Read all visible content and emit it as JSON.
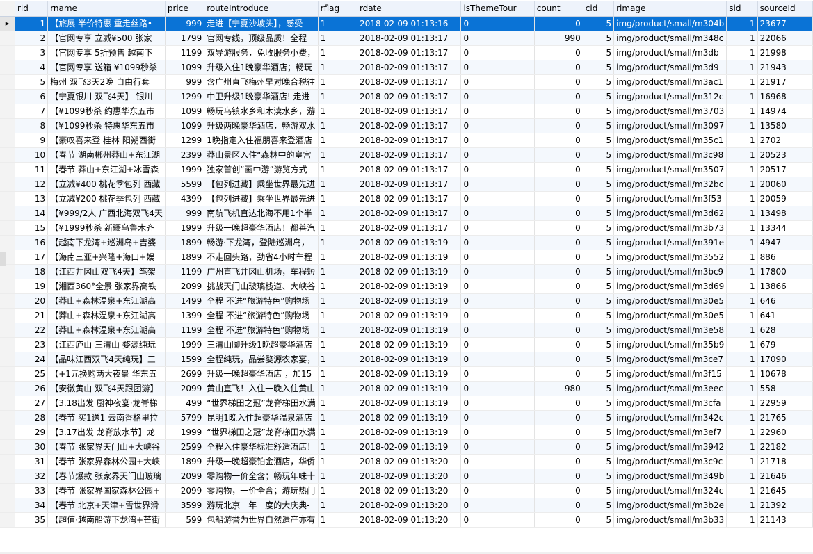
{
  "columns": [
    "rid",
    "rname",
    "price",
    "routeIntroduce",
    "rflag",
    "rdate",
    "isThemeTour",
    "count",
    "cid",
    "rimage",
    "sid",
    "sourceId"
  ],
  "current_row_marker": "▸",
  "selected_row_index": 0,
  "rows": [
    [
      "1",
      "【旅展 半价特惠 重走丝路•",
      "999",
      "走进【宁夏沙坡头】，感受",
      "1",
      "2018-02-09 01:13:16",
      "0",
      "0",
      "5",
      "img/product/small/m304b",
      "1",
      "23677"
    ],
    [
      "2",
      "【官网专享 立减¥500 张家",
      "1799",
      "官网专线，顶级品质！全程",
      "1",
      "2018-02-09 01:13:17",
      "0",
      "990",
      "5",
      "img/product/small/m348c",
      "1",
      "22066"
    ],
    [
      "3",
      "【官网专享 5折预售 越南下",
      "1199",
      "双导游服务，免收服务小费，",
      "1",
      "2018-02-09 01:13:17",
      "0",
      "0",
      "5",
      "img/product/small/m3db",
      "1",
      "21998"
    ],
    [
      "4",
      "【官网专享 送箱 ¥1099秒杀",
      "1099",
      "升级入住1晚豪华酒店；畅玩",
      "1",
      "2018-02-09 01:13:17",
      "0",
      "0",
      "5",
      "img/product/small/m3d9",
      "1",
      "21943"
    ],
    [
      "5",
      "梅州 双飞3天2晚 自由行套",
      "999",
      "含广州直飞梅州早对晚合税往",
      "1",
      "2018-02-09 01:13:17",
      "0",
      "0",
      "5",
      "img/product/small/m3ac1",
      "1",
      "21917"
    ],
    [
      "6",
      "【宁夏银川 双飞4天】 银川",
      "1299",
      "中卫升级1晚豪华酒店! 走进",
      "1",
      "2018-02-09 01:13:17",
      "0",
      "0",
      "5",
      "img/product/small/m312c",
      "1",
      "16968"
    ],
    [
      "7",
      "【¥1099秒杀 约惠华东五市",
      "1099",
      "畅玩乌镇水乡和木渎水乡，游",
      "1",
      "2018-02-09 01:13:17",
      "0",
      "0",
      "5",
      "img/product/small/m3703",
      "1",
      "14974"
    ],
    [
      "8",
      "【¥1099秒杀 特惠华东五市",
      "1099",
      "升级两晚豪华酒店，畅游双水",
      "1",
      "2018-02-09 01:13:17",
      "0",
      "0",
      "5",
      "img/product/small/m3097",
      "1",
      "13580"
    ],
    [
      "9",
      "【豪叹喜来登 桂林 阳朔西街",
      "1299",
      "1晚指定入住福朋喜来登酒店",
      "1",
      "2018-02-09 01:13:17",
      "0",
      "0",
      "5",
      "img/product/small/m35c1",
      "1",
      "2702"
    ],
    [
      "10",
      "【春节 湖南郴州莽山+东江湖",
      "2399",
      "莽山景区入住“森林中的皇宫",
      "1",
      "2018-02-09 01:13:17",
      "0",
      "0",
      "5",
      "img/product/small/m3c98",
      "1",
      "20523"
    ],
    [
      "11",
      "【春节 莽山+东江湖+冰雪森",
      "1999",
      "独家首创“画中游”游览方式-",
      "1",
      "2018-02-09 01:13:17",
      "0",
      "0",
      "5",
      "img/product/small/m3507",
      "1",
      "20517"
    ],
    [
      "12",
      "【立减¥400 桃花季包列 西藏",
      "5599",
      "【包列进藏】乘坐世界最先进",
      "1",
      "2018-02-09 01:13:17",
      "0",
      "0",
      "5",
      "img/product/small/m32bc",
      "1",
      "20060"
    ],
    [
      "13",
      "【立减¥200 桃花季包列 西藏",
      "4399",
      "【包列进藏】乘坐世界最先进",
      "1",
      "2018-02-09 01:13:17",
      "0",
      "0",
      "5",
      "img/product/small/m3f53",
      "1",
      "20059"
    ],
    [
      "14",
      "【¥999/2人 广西北海双飞4天",
      "999",
      "南航飞机直达北海不用1个半",
      "1",
      "2018-02-09 01:13:17",
      "0",
      "0",
      "5",
      "img/product/small/m3d62",
      "1",
      "13498"
    ],
    [
      "15",
      "【¥1999秒杀 新疆乌鲁木齐",
      "1999",
      "升级一晚超豪华酒店！都善汽",
      "1",
      "2018-02-09 01:13:17",
      "0",
      "0",
      "5",
      "img/product/small/m3b73",
      "1",
      "13344"
    ],
    [
      "16",
      "【越南下龙湾+巡洲岛+吉婆",
      "1899",
      "畅游·下龙湾，登陆巡洲岛，",
      "1",
      "2018-02-09 01:13:19",
      "0",
      "0",
      "5",
      "img/product/small/m391e",
      "1",
      "4947"
    ],
    [
      "17",
      "【海南三亚+兴隆+海口+娱",
      "1899",
      "不走回头路，劲省4小时车程",
      "1",
      "2018-02-09 01:13:19",
      "0",
      "0",
      "5",
      "img/product/small/m3552",
      "1",
      "886"
    ],
    [
      "18",
      "【江西井冈山双飞4天】笔架",
      "1199",
      "广州直飞井冈山机场，车程短",
      "1",
      "2018-02-09 01:13:19",
      "0",
      "0",
      "5",
      "img/product/small/m3bc9",
      "1",
      "17800"
    ],
    [
      "19",
      "【湘西360°全景 张家界高铁",
      "2099",
      "挑战天门山玻璃栈道、大峡谷",
      "1",
      "2018-02-09 01:13:19",
      "0",
      "0",
      "5",
      "img/product/small/m3d69",
      "1",
      "13866"
    ],
    [
      "20",
      "【莽山+森林温泉+东江湖高",
      "1499",
      "全程 不进“旅游特色”购物场",
      "1",
      "2018-02-09 01:13:19",
      "0",
      "0",
      "5",
      "img/product/small/m30e5",
      "1",
      "646"
    ],
    [
      "21",
      "【莽山+森林温泉+东江湖高",
      "1399",
      "全程 不进“旅游特色”购物场",
      "1",
      "2018-02-09 01:13:19",
      "0",
      "0",
      "5",
      "img/product/small/m30e5",
      "1",
      "641"
    ],
    [
      "22",
      "【莽山+森林温泉+东江湖高",
      "1199",
      "全程 不进“旅游特色”购物场",
      "1",
      "2018-02-09 01:13:19",
      "0",
      "0",
      "5",
      "img/product/small/m3e58",
      "1",
      "628"
    ],
    [
      "23",
      "【江西庐山 三清山 婺源纯玩",
      "1999",
      "三清山脚升级1晚超豪华酒店",
      "1",
      "2018-02-09 01:13:19",
      "0",
      "0",
      "5",
      "img/product/small/m35b9",
      "1",
      "679"
    ],
    [
      "24",
      "【品味江西双飞4天纯玩】三",
      "1599",
      "全程纯玩，品尝婺源农家宴，",
      "1",
      "2018-02-09 01:13:19",
      "0",
      "0",
      "5",
      "img/product/small/m3ce7",
      "1",
      "17090"
    ],
    [
      "25",
      "【+1元换购两大夜景 华东五",
      "2699",
      "升级一晚超豪华酒店 ，加15",
      "1",
      "2018-02-09 01:13:19",
      "0",
      "0",
      "5",
      "img/product/small/m3f15",
      "1",
      "10678"
    ],
    [
      "26",
      "【安徽黄山 双飞4天跟团游】",
      "2099",
      "黄山直飞！入住一晚入住黄山",
      "1",
      "2018-02-09 01:13:19",
      "0",
      "980",
      "5",
      "img/product/small/m3eec",
      "1",
      "558"
    ],
    [
      "27",
      "【3.18出发 厨神夜宴·龙脊梯",
      "499",
      "“世界梯田之冠”龙脊梯田水满",
      "1",
      "2018-02-09 01:13:19",
      "0",
      "0",
      "5",
      "img/product/small/m3cfa",
      "1",
      "22959"
    ],
    [
      "28",
      "【春节 买1送1 云南香格里拉",
      "5799",
      "昆明1晚入住超豪华温泉酒店",
      "1",
      "2018-02-09 01:13:19",
      "0",
      "0",
      "5",
      "img/product/small/m342c",
      "1",
      "21765"
    ],
    [
      "29",
      "【3.17出发 龙脊放水节】龙",
      "1999",
      "“世界梯田之冠”龙脊梯田水满",
      "1",
      "2018-02-09 01:13:19",
      "0",
      "0",
      "5",
      "img/product/small/m3ef7",
      "1",
      "22960"
    ],
    [
      "30",
      "【春节 张家界天门山+大峡谷",
      "2599",
      "全程入住豪华标准舒适酒店！",
      "1",
      "2018-02-09 01:13:19",
      "0",
      "0",
      "5",
      "img/product/small/m3942",
      "1",
      "22182"
    ],
    [
      "31",
      "【春节 张家界森林公园+大峡",
      "1899",
      "升级一晚超豪铂金酒店，华侨",
      "1",
      "2018-02-09 01:13:20",
      "0",
      "0",
      "5",
      "img/product/small/m3c9c",
      "1",
      "21718"
    ],
    [
      "32",
      "【春节爆款 张家界天门山玻璃",
      "2099",
      "零购物一价全含；畅玩年味十",
      "1",
      "2018-02-09 01:13:20",
      "0",
      "0",
      "5",
      "img/product/small/m349b",
      "1",
      "21646"
    ],
    [
      "33",
      "【春节 张家界国家森林公园+",
      "2099",
      "零购物，一价全含；游玩热门",
      "1",
      "2018-02-09 01:13:20",
      "0",
      "0",
      "5",
      "img/product/small/m324c",
      "1",
      "21645"
    ],
    [
      "34",
      "【春节 北京+天津+雪世界滑",
      "3599",
      "游玩北京一年一度的大庆典-",
      "1",
      "2018-02-09 01:13:20",
      "0",
      "0",
      "5",
      "img/product/small/m3b2e",
      "1",
      "21392"
    ],
    [
      "35",
      "【超值·越南船游下龙湾+芒街",
      "599",
      "包船游誉为世界自然遗产亦有",
      "1",
      "2018-02-09 01:13:20",
      "0",
      "0",
      "5",
      "img/product/small/m3b33",
      "1",
      "21143"
    ]
  ]
}
